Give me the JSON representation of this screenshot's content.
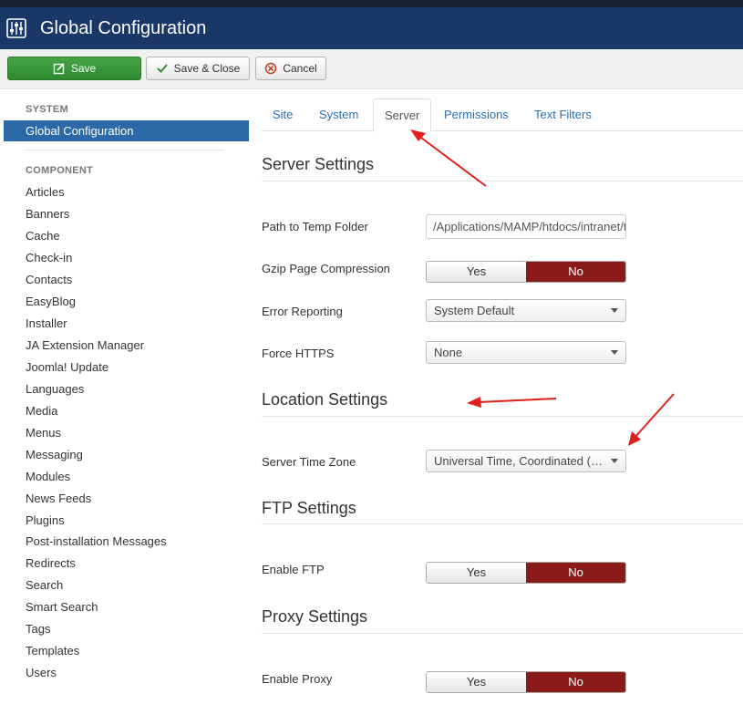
{
  "header": {
    "title": "Global Configuration",
    "logo_icon": "joomla-config-icon"
  },
  "toolbar": {
    "save_label": "Save",
    "save_close_label": "Save & Close",
    "cancel_label": "Cancel"
  },
  "sidebar": {
    "system_heading": "SYSTEM",
    "active_item": "Global Configuration",
    "component_heading": "COMPONENT",
    "items": [
      "Articles",
      "Banners",
      "Cache",
      "Check-in",
      "Contacts",
      "EasyBlog",
      "Installer",
      "JA Extension Manager",
      "Joomla! Update",
      "Languages",
      "Media",
      "Menus",
      "Messaging",
      "Modules",
      "News Feeds",
      "Plugins",
      "Post-installation Messages",
      "Redirects",
      "Search",
      "Smart Search",
      "Tags",
      "Templates",
      "Users"
    ]
  },
  "tabs": [
    "Site",
    "System",
    "Server",
    "Permissions",
    "Text Filters"
  ],
  "active_tab": "Server",
  "server": {
    "title": "Server Settings",
    "temp_label": "Path to Temp Folder",
    "temp_value": "/Applications/MAMP/htdocs/intranet/tmp",
    "gzip_label": "Gzip Page Compression",
    "error_label": "Error Reporting",
    "error_value": "System Default",
    "https_label": "Force HTTPS",
    "https_value": "None"
  },
  "location": {
    "title": "Location Settings",
    "tz_label": "Server Time Zone",
    "tz_value": "Universal Time, Coordinated (UTC)"
  },
  "ftp": {
    "title": "FTP Settings",
    "enable_label": "Enable FTP"
  },
  "proxy": {
    "title": "Proxy Settings",
    "enable_label": "Enable Proxy"
  },
  "toggle": {
    "yes": "Yes",
    "no": "No",
    "selected": "No"
  },
  "colors": {
    "header": "#1a3867",
    "save_button": "#3f9e3f",
    "active_sidebar": "#2d69a6",
    "toggle_no": "#8b1a1a",
    "annotation_arrow": "#e0201b"
  }
}
